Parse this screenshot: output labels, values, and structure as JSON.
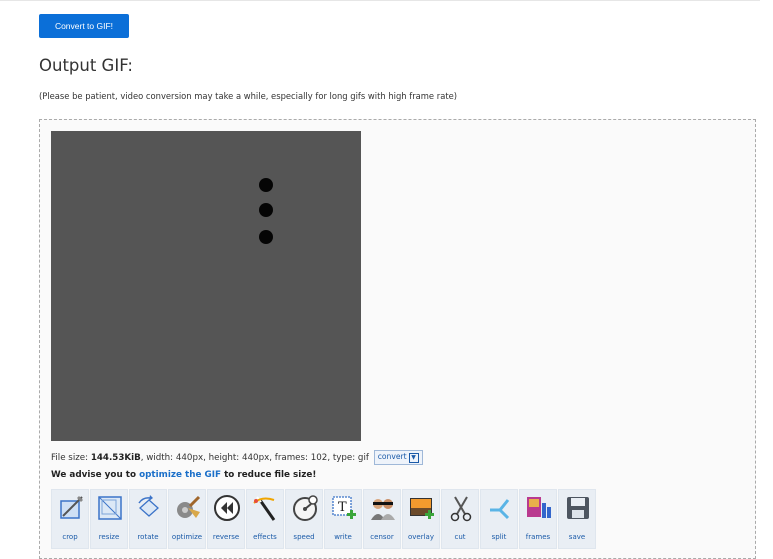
{
  "convert_button": "Convert to GIF!",
  "output_heading": "Output GIF:",
  "note": "(Please be patient, video conversion may take a while, especially for long gifs with high frame rate)",
  "file_info": {
    "prefix": "File size: ",
    "size": "144.53KiB",
    "rest": ", width: 440px, height: 440px, frames: 102, type: gif",
    "convert_label": "convert"
  },
  "advice": {
    "before": "We advise you to ",
    "link": "optimize the GIF",
    "after": " to reduce file size!"
  },
  "tools": [
    {
      "label": "crop",
      "icon": "crop-icon"
    },
    {
      "label": "resize",
      "icon": "resize-icon"
    },
    {
      "label": "rotate",
      "icon": "rotate-icon"
    },
    {
      "label": "optimize",
      "icon": "optimize-icon"
    },
    {
      "label": "reverse",
      "icon": "reverse-icon"
    },
    {
      "label": "effects",
      "icon": "effects-icon"
    },
    {
      "label": "speed",
      "icon": "speed-icon"
    },
    {
      "label": "write",
      "icon": "write-icon"
    },
    {
      "label": "censor",
      "icon": "censor-icon"
    },
    {
      "label": "overlay",
      "icon": "overlay-icon"
    },
    {
      "label": "cut",
      "icon": "cut-icon"
    },
    {
      "label": "split",
      "icon": "split-icon"
    },
    {
      "label": "frames",
      "icon": "frames-icon"
    },
    {
      "label": "save",
      "icon": "save-icon"
    }
  ],
  "colors": {
    "accent": "#0b6fd8",
    "link": "#1a6fc9",
    "preview_bg": "#555555"
  }
}
